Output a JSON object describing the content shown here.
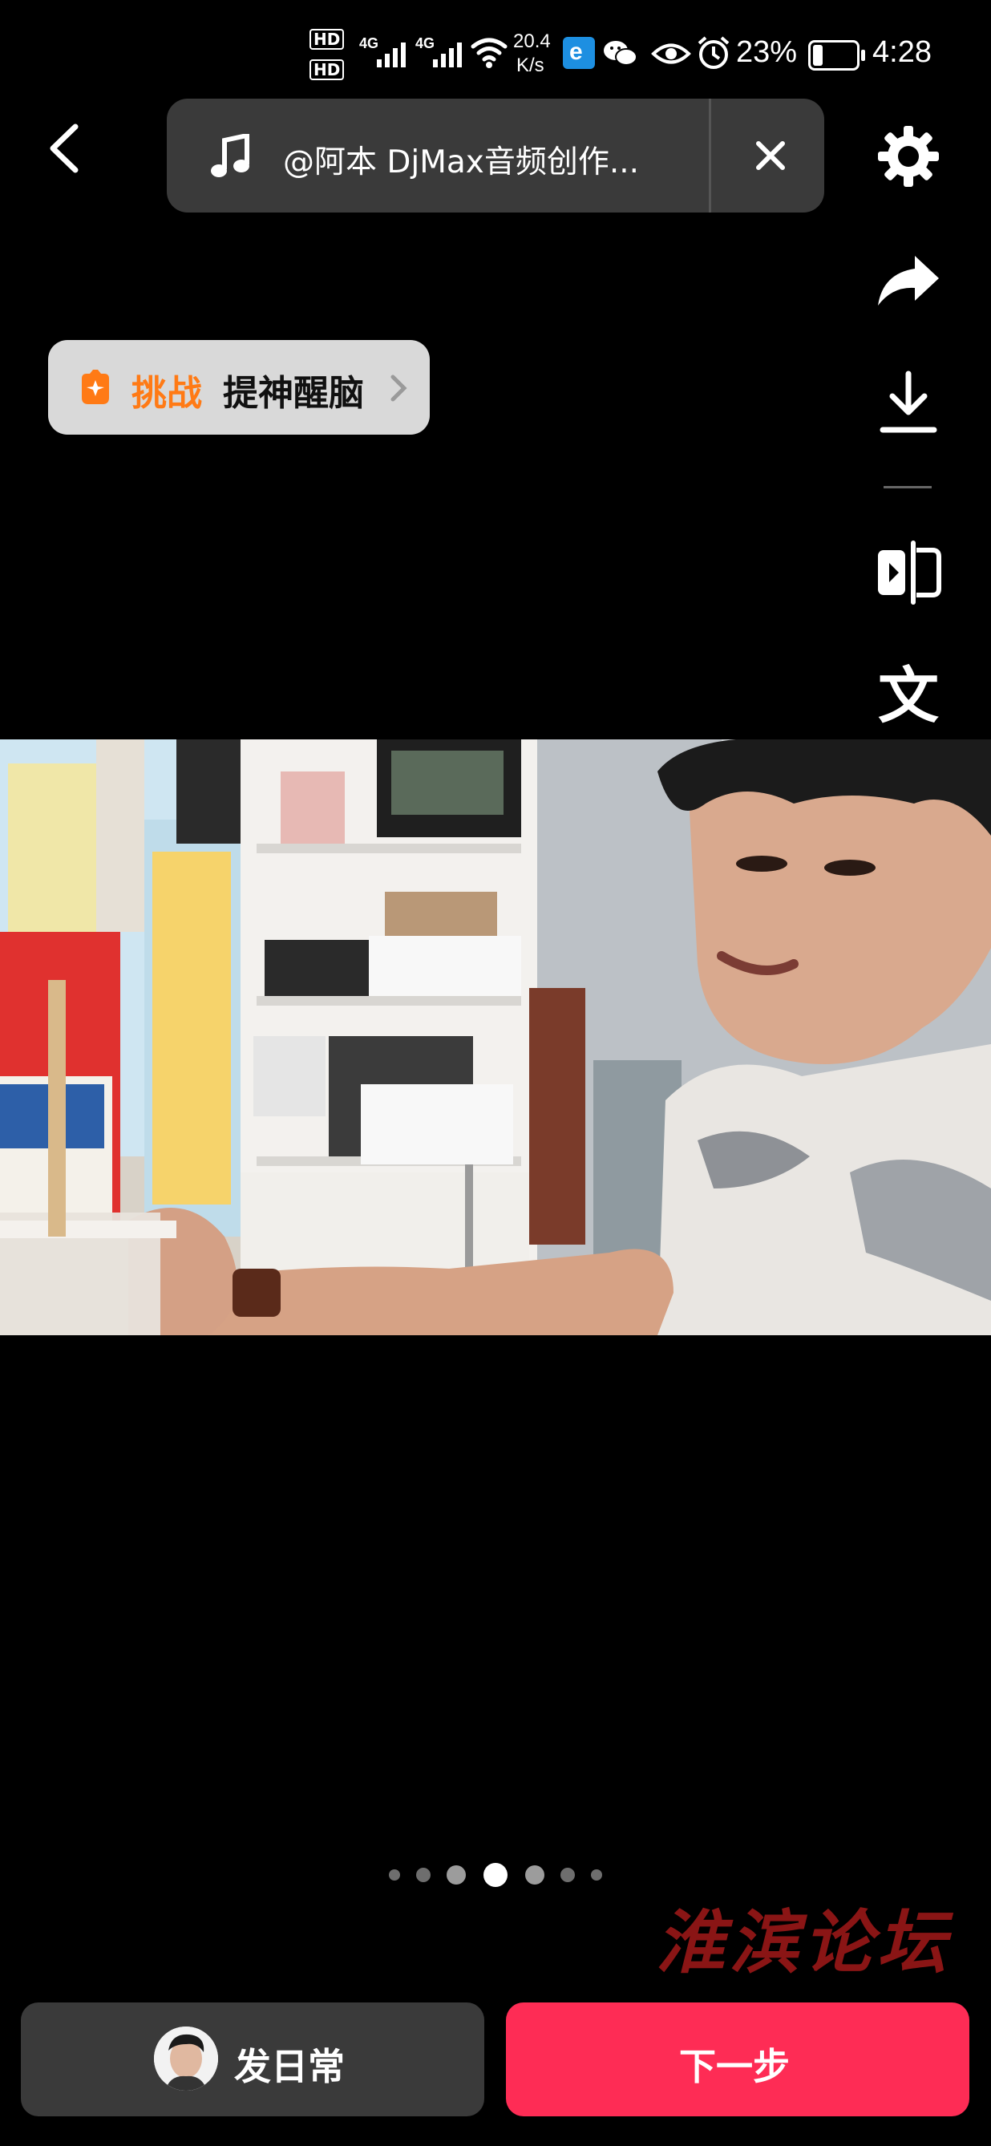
{
  "status_bar": {
    "hd1": "HD",
    "hd2": "HD",
    "net1": "4G",
    "net2": "4G",
    "speed_value": "20.4",
    "speed_unit": "K/s",
    "battery": "23%",
    "time": "4:28"
  },
  "music": {
    "title": "@阿本 DjMax音频创作..."
  },
  "challenge": {
    "prefix": "挑战",
    "name": "提神醒脑"
  },
  "rail_icons": [
    "gear-icon",
    "share-icon",
    "download-icon",
    "flip-icon",
    "text-icon",
    "effects-icon",
    "sticker-icon",
    "expand-icon"
  ],
  "pagination": {
    "count": 7,
    "active_index": 3
  },
  "watermark": "淮滨论坛",
  "bottom": {
    "daily_label": "发日常",
    "next_label": "下一步"
  },
  "colors": {
    "accent_orange": "#ff7a15",
    "next_button": "#fe2c55",
    "pill_bg": "#3a3a3a"
  }
}
